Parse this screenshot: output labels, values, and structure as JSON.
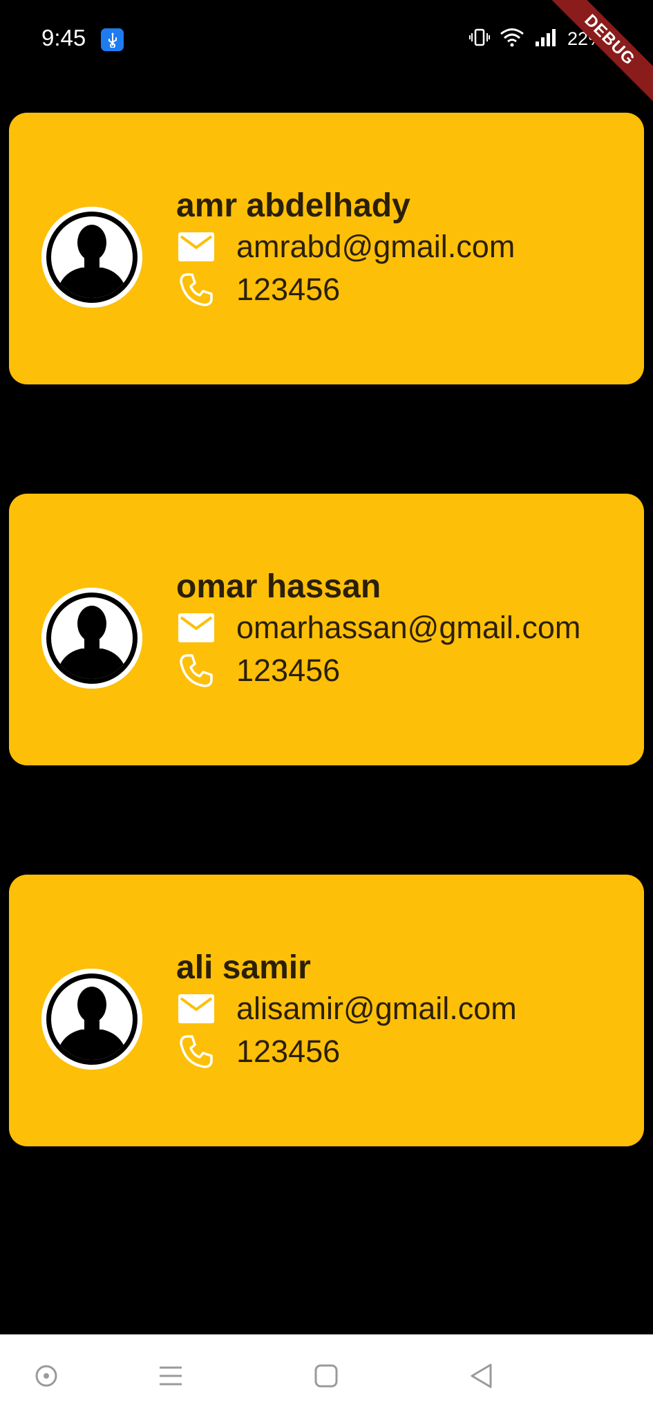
{
  "status_bar": {
    "time": "9:45",
    "battery": "22%",
    "icons": [
      "usb-icon",
      "vibrate-icon",
      "wifi-icon",
      "signal-icon"
    ]
  },
  "debug_banner": "DEBUG",
  "colors": {
    "background": "#000000",
    "card": "#fdbf08",
    "text": "#2a1f08",
    "icon": "#ffffff"
  },
  "contacts": [
    {
      "name": "amr abdelhady",
      "email": "amrabd@gmail.com",
      "phone": "123456"
    },
    {
      "name": "omar hassan",
      "email": "omarhassan@gmail.com",
      "phone": "123456"
    },
    {
      "name": "ali samir",
      "email": "alisamir@gmail.com",
      "phone": "123456"
    }
  ],
  "nav_bar": {
    "items": [
      "assistant-icon",
      "menu-icon",
      "home-icon",
      "back-icon"
    ]
  }
}
